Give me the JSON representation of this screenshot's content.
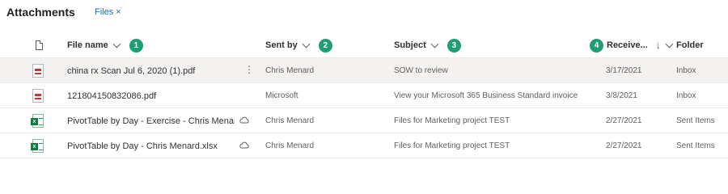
{
  "header": {
    "title": "Attachments",
    "filter_label": "Files",
    "filter_close": "×"
  },
  "columns": {
    "file_name": "File name",
    "sent_by": "Sent by",
    "subject": "Subject",
    "received": "Receive...",
    "folder": "Folder",
    "sort_arrow": "↓"
  },
  "badges": [
    "1",
    "2",
    "3",
    "4"
  ],
  "rows": [
    {
      "icon": "pdf-icon",
      "name": "china rx Scan Jul 6, 2020 (1).pdf",
      "sent_by": "Chris Menard",
      "subject": "SOW to review",
      "received": "3/17/2021",
      "folder": "Inbox",
      "action": "⋮"
    },
    {
      "icon": "pdf-icon",
      "name": "121804150832086.pdf",
      "sent_by": "Microsoft",
      "subject": "View your Microsoft 365 Business Standard invoice",
      "received": "3/8/2021",
      "folder": "Inbox",
      "action": ""
    },
    {
      "icon": "excel-icon",
      "name": "PivotTable by Day - Exercise - Chris Menard.x...",
      "sent_by": "Chris Menard",
      "subject": "Files for Marketing project TEST",
      "received": "2/27/2021",
      "folder": "Sent Items",
      "action": "cloud"
    },
    {
      "icon": "excel-icon",
      "name": "PivotTable by Day - Chris Menard.xlsx",
      "sent_by": "Chris Menard",
      "subject": "Files for Marketing project TEST",
      "received": "2/27/2021",
      "folder": "Sent Items",
      "action": "cloud"
    }
  ],
  "colors": {
    "accent": "#106ebe",
    "badge": "#1f9e74",
    "pdf": "#d13438",
    "excel": "#107c41",
    "selected_row": "#f3f2f1"
  }
}
